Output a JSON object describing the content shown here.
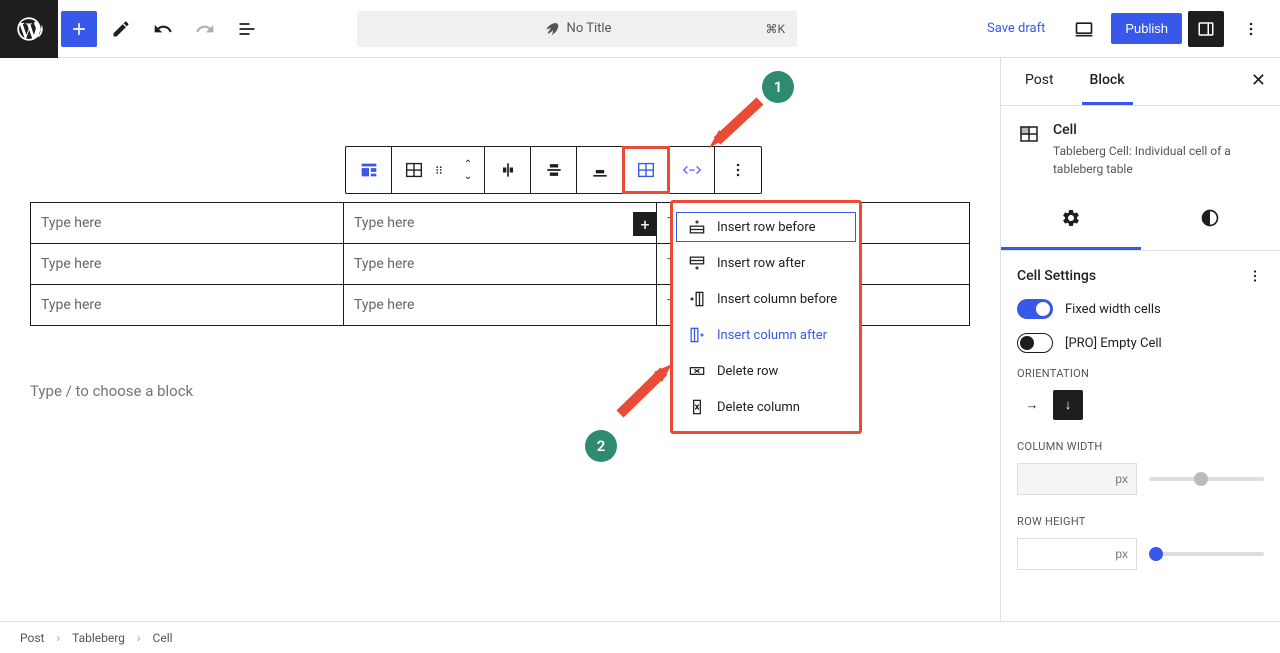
{
  "topbar": {
    "doc_title": "No Title",
    "shortcut": "⌘K",
    "save_draft": "Save draft",
    "publish": "Publish"
  },
  "toolbar": {
    "items": [
      "block-type",
      "drag",
      "move",
      "align-vert",
      "align-horiz",
      "align-item",
      "table-edit",
      "width",
      "more"
    ]
  },
  "table": {
    "rows": [
      [
        "Type here",
        "Type here",
        "Type here"
      ],
      [
        "Type here",
        "Type here",
        "Type here"
      ],
      [
        "Type here",
        "Type here",
        "Type here"
      ]
    ]
  },
  "slash_hint": "Type / to choose a block",
  "dropdown": {
    "items": [
      {
        "label": "Insert row before",
        "selected": true
      },
      {
        "label": "Insert row after"
      },
      {
        "label": "Insert column before"
      },
      {
        "label": "Insert column after",
        "active": true
      },
      {
        "label": "Delete row"
      },
      {
        "label": "Delete column"
      }
    ]
  },
  "annotations": {
    "a1": "1",
    "a2": "2"
  },
  "sidebar": {
    "tabs": {
      "post": "Post",
      "block": "Block"
    },
    "block": {
      "title": "Cell",
      "desc": "Tableberg Cell: Individual cell of a tableberg table"
    },
    "section": {
      "title": "Cell Settings",
      "fixed_width": "Fixed width cells",
      "empty_cell": "[PRO] Empty Cell",
      "orientation": "ORIENTATION",
      "col_width": "COLUMN WIDTH",
      "row_height": "ROW HEIGHT",
      "unit": "px"
    }
  },
  "breadcrumb": [
    "Post",
    "Tableberg",
    "Cell"
  ]
}
